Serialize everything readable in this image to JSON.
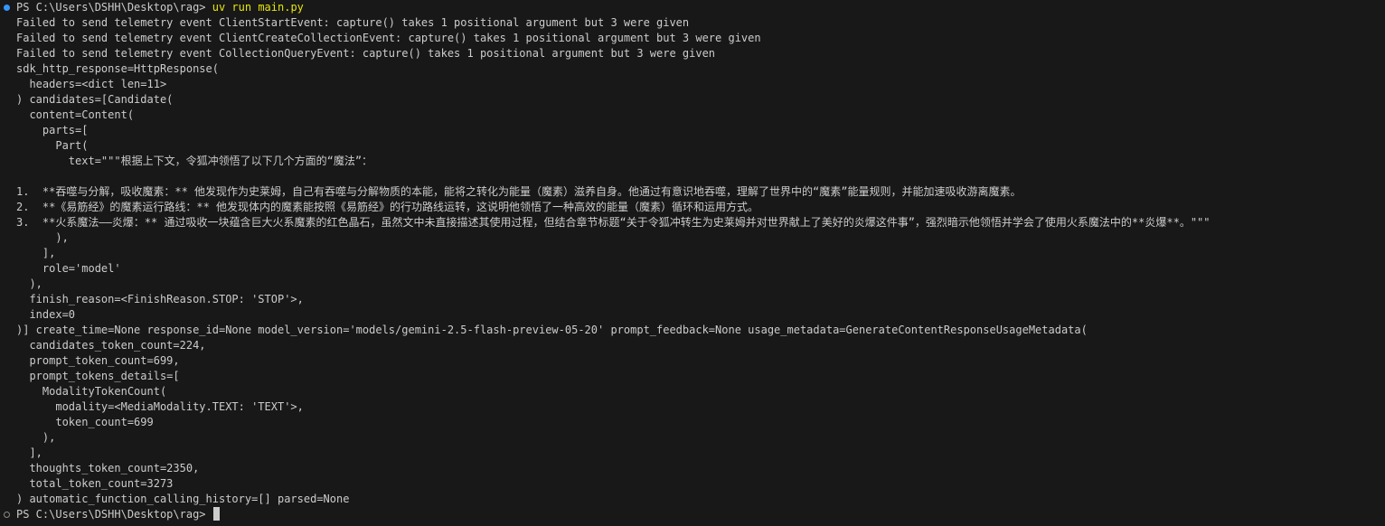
{
  "terminal": {
    "prompt": "PS C:\\Users\\DSHH\\Desktop\\rag> ",
    "command": "uv run main.py",
    "output": [
      "Failed to send telemetry event ClientStartEvent: capture() takes 1 positional argument but 3 were given",
      "Failed to send telemetry event ClientCreateCollectionEvent: capture() takes 1 positional argument but 3 were given",
      "Failed to send telemetry event CollectionQueryEvent: capture() takes 1 positional argument but 3 were given",
      "sdk_http_response=HttpResponse(",
      "  headers=<dict len=11>",
      ") candidates=[Candidate(",
      "  content=Content(",
      "    parts=[",
      "      Part(",
      "        text=\"\"\"根据上下文，令狐冲领悟了以下几个方面的“魔法”：",
      "",
      "1.  **吞噬与分解，吸收魔素：** 他发现作为史莱姆，自己有吞噬与分解物质的本能，能将之转化为能量（魔素）滋养自身。他通过有意识地吞噬，理解了世界中的“魔素”能量规则，并能加速吸收游离魔素。",
      "2.  **《易筋经》的魔素运行路线：** 他发现体内的魔素能按照《易筋经》的行功路线运转，这说明他领悟了一种高效的能量（魔素）循环和运用方式。",
      "3.  **火系魔法——炎爆：** 通过吸收一块蕴含巨大火系魔素的红色晶石，虽然文中未直接描述其使用过程，但结合章节标题“关于令狐冲转生为史莱姆并对世界献上了美好的炎爆这件事”，强烈暗示他领悟并学会了使用火系魔法中的**炎爆**。\"\"\"",
      "      ),",
      "    ],",
      "    role='model'",
      "  ),",
      "  finish_reason=<FinishReason.STOP: 'STOP'>,",
      "  index=0",
      ")] create_time=None response_id=None model_version='models/gemini-2.5-flash-preview-05-20' prompt_feedback=None usage_metadata=GenerateContentResponseUsageMetadata(",
      "  candidates_token_count=224,",
      "  prompt_token_count=699,",
      "  prompt_tokens_details=[",
      "    ModalityTokenCount(",
      "      modality=<MediaModality.TEXT: 'TEXT'>,",
      "      token_count=699",
      "    ),",
      "  ],",
      "  thoughts_token_count=2350,",
      "  total_token_count=3273",
      ") automatic_function_calling_history=[] parsed=None"
    ],
    "final_prompt": "PS C:\\Users\\DSHH\\Desktop\\rag> "
  },
  "colors": {
    "background": "#181818",
    "foreground": "#cccccc",
    "command": "#e5e510",
    "success_marker": "#3794ff"
  },
  "icons": {
    "command_success": "filled-circle",
    "command_idle": "hollow-circle"
  }
}
